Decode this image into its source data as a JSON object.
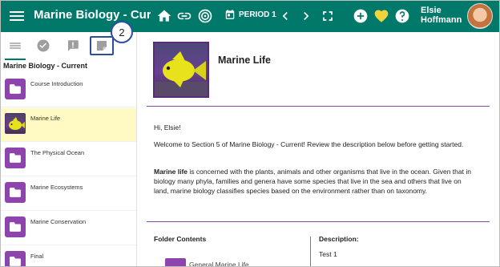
{
  "header": {
    "title": "Marine Biology - Curre...",
    "period": "PERIOD 1",
    "user_name": "Elsie Hoffmann",
    "icons": [
      "menu-icon",
      "home-icon",
      "link-icon",
      "target-icon",
      "calendar-icon",
      "chevron-left-icon",
      "chevron-right-icon",
      "fullscreen-icon",
      "add-icon",
      "heart-icon",
      "help-icon"
    ]
  },
  "sidebar": {
    "section_title": "Marine Biology - Current",
    "tabs": [
      "list-icon",
      "check-circle-icon",
      "alert-icon",
      "note-icon"
    ],
    "items": [
      {
        "label": "Course Introduction",
        "active": false
      },
      {
        "label": "Marine Life",
        "active": true
      },
      {
        "label": "The Physical Ocean",
        "active": false
      },
      {
        "label": "Marine Ecosystems",
        "active": false
      },
      {
        "label": "Marine Conservation",
        "active": false
      },
      {
        "label": "Final",
        "active": false
      }
    ]
  },
  "callout": {
    "number": "2"
  },
  "main": {
    "title": "Marine Life",
    "greeting": "Hi, Elsie!",
    "welcome": "Welcome to Section 5 of Marine Biology - Current! Review the description below before getting started.",
    "body_bold": "Marine life",
    "body_rest": " is concerned with the plants, animals and other organisms that live in the ocean. Given that in biology many phyla, families and genera have some species that live in the sea and others that live on land, marine biology classifies species based on the environment rather than on taxonomy.",
    "folder_contents_label": "Folder Contents",
    "description_label": "Description:",
    "description_value": "Test 1",
    "folder_item": "General Marine Life"
  },
  "colors": {
    "topbar": "#00796b",
    "accent": "#8e44ad",
    "active_item": "#fff9c4",
    "callout": "#2c4e9c"
  }
}
